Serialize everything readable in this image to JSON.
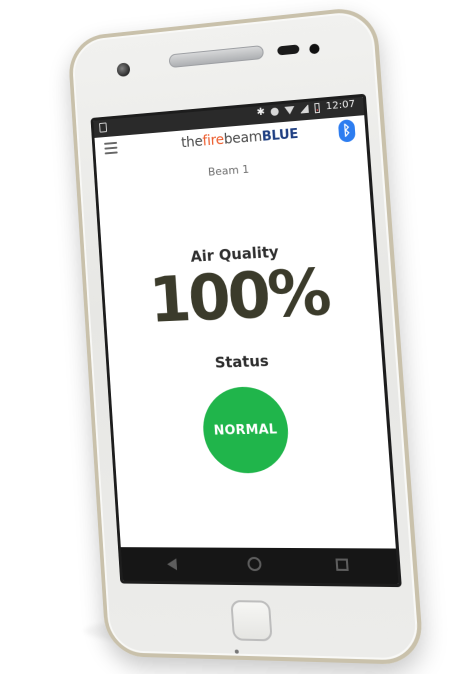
{
  "statusbar": {
    "time": "12:07",
    "icons": [
      "bluetooth-icon",
      "dnd-icon",
      "wifi-icon",
      "signal-icon",
      "battery-icon"
    ]
  },
  "appbar": {
    "logo": {
      "part1": "the",
      "part2": "fire",
      "part3": "beam",
      "part4": "BLUE"
    }
  },
  "main": {
    "beam_name": "Beam 1",
    "air_quality_label": "Air Quality",
    "air_quality_value": "100%",
    "status_label": "Status",
    "status_value": "NORMAL"
  },
  "colors": {
    "status_normal": "#20b54b",
    "logo_fire": "#ec5a2a",
    "logo_blue": "#1f3f82",
    "bluetooth_button": "#2d7df0"
  }
}
